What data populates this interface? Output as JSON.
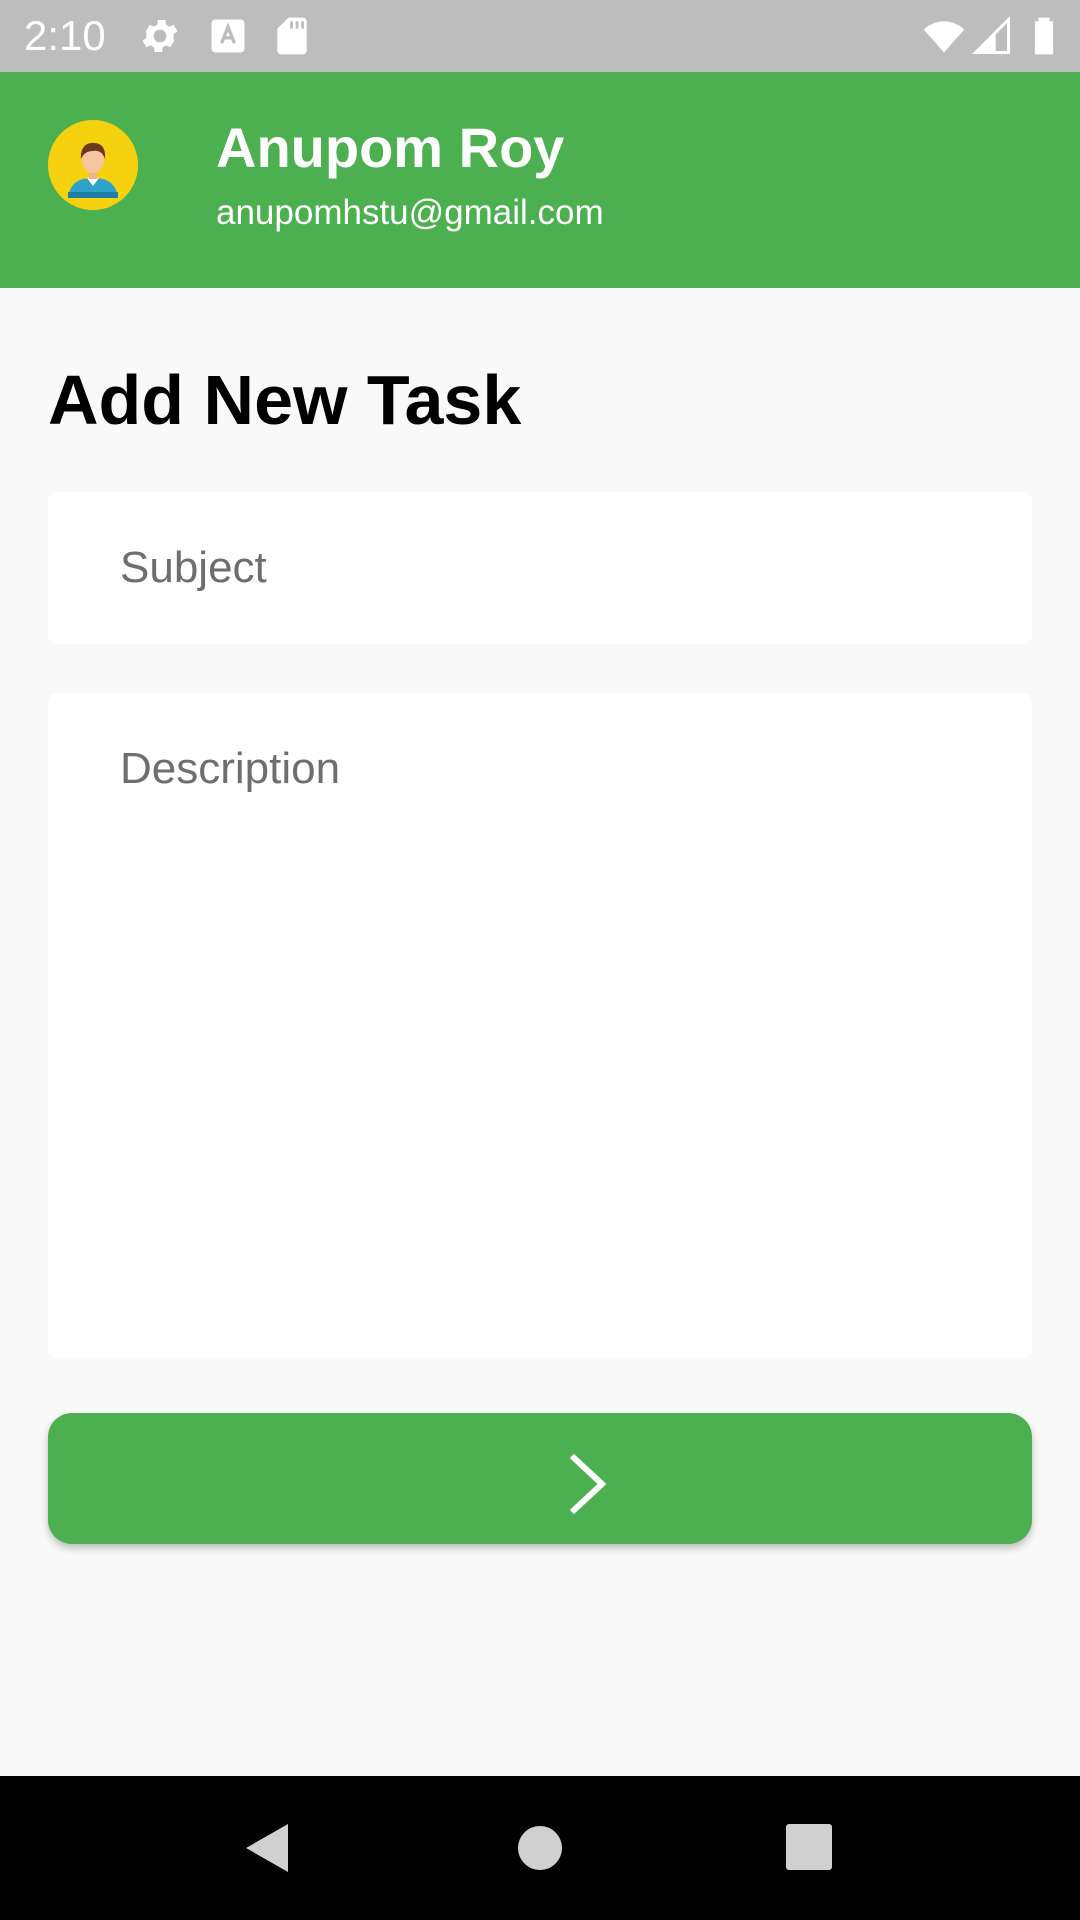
{
  "status_bar": {
    "time": "2:10",
    "icons": [
      "settings-icon",
      "text-a-icon",
      "sd-card-icon",
      "wifi-icon",
      "signal-icon",
      "battery-icon"
    ]
  },
  "header": {
    "avatar_icon": "user-avatar-icon",
    "name": "Anupom Roy",
    "email": "anupomhstu@gmail.com"
  },
  "main": {
    "title": "Add New Task",
    "subject_placeholder": "Subject",
    "description_placeholder": "Description",
    "submit_icon": "chevron-right-icon"
  },
  "nav_bar": {
    "icons": [
      "back-icon",
      "home-icon",
      "recents-icon"
    ]
  },
  "colors": {
    "accent": "#4caf50",
    "status_bar": "#bdbdbd",
    "background": "#f9f9f9",
    "avatar_bg": "#f5d110"
  }
}
